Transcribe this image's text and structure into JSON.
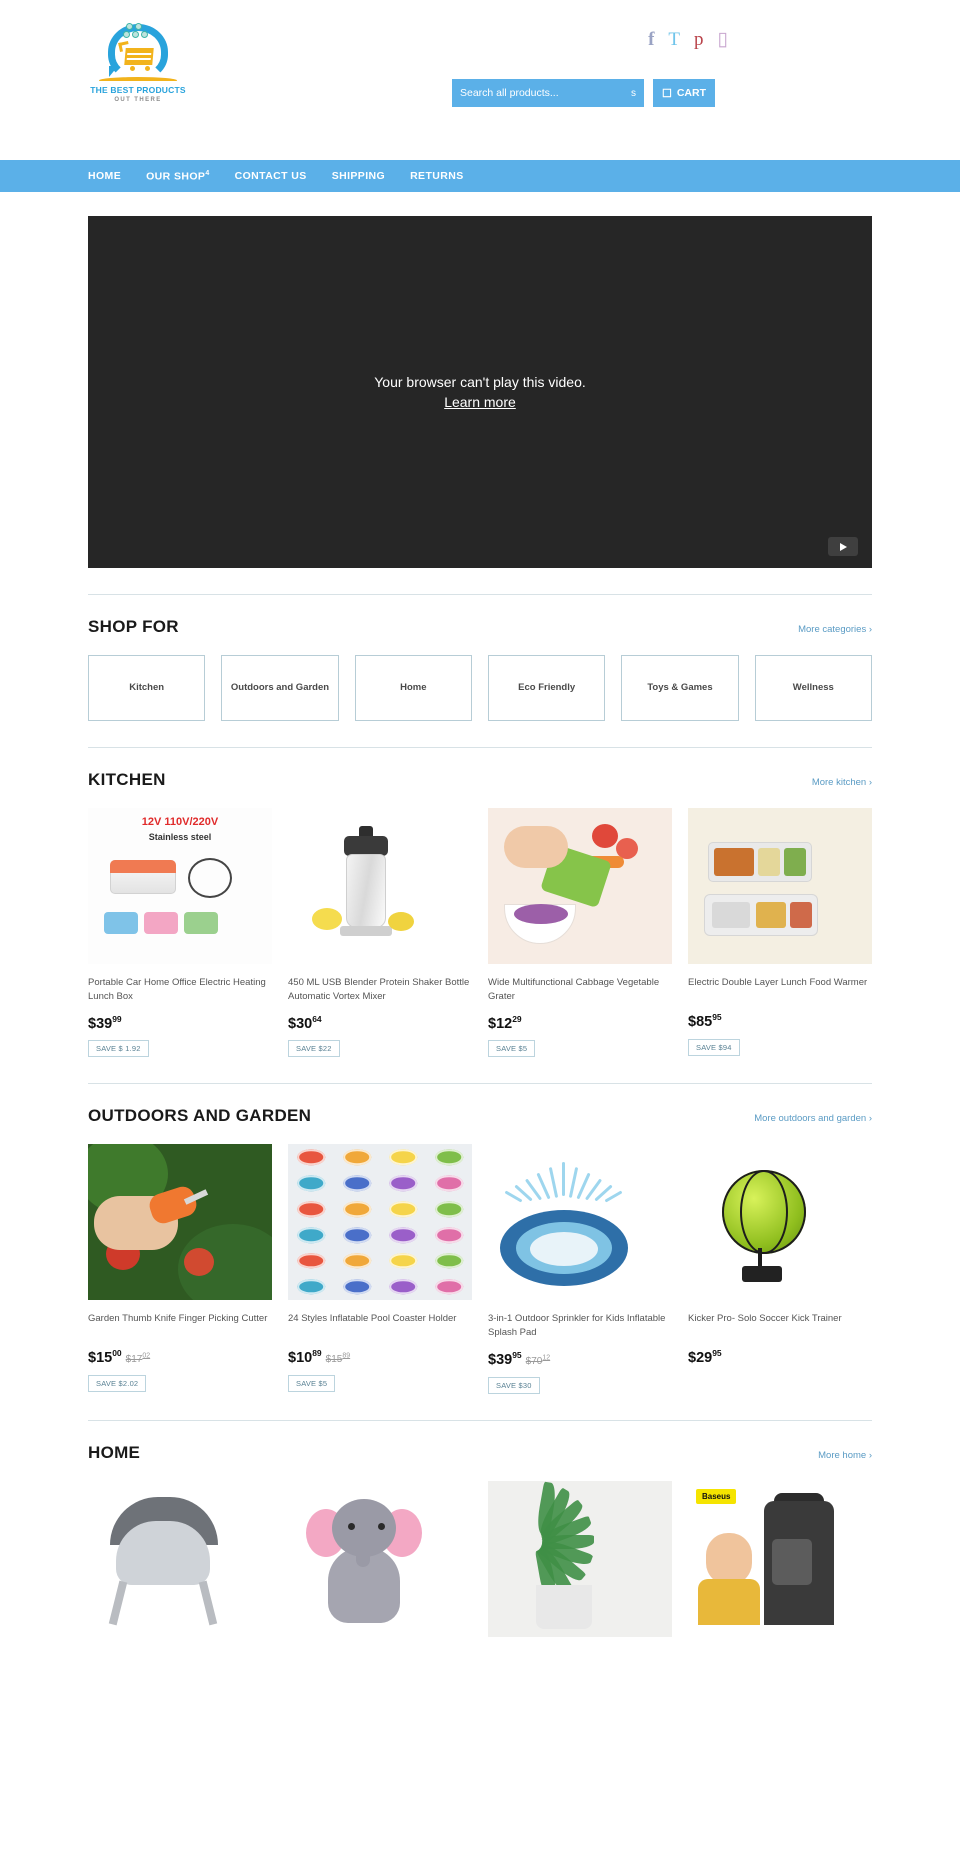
{
  "header": {
    "logo": {
      "name_line1": "THE BEST PRODUCTS",
      "name_line2": "OUT THERE"
    },
    "social": [
      {
        "name": "facebook-icon",
        "glyph": "f"
      },
      {
        "name": "twitter-icon",
        "glyph": "T"
      },
      {
        "name": "pinterest-icon",
        "glyph": "p"
      },
      {
        "name": "instagram-icon",
        "glyph": "▯"
      }
    ],
    "search": {
      "placeholder": "Search all products...",
      "icon": "s"
    },
    "cart": {
      "label": "CART",
      "icon": "☐"
    }
  },
  "nav": [
    {
      "label": "HOME",
      "badge": ""
    },
    {
      "label": "OUR SHOP",
      "badge": "4"
    },
    {
      "label": "CONTACT US",
      "badge": ""
    },
    {
      "label": "SHIPPING",
      "badge": ""
    },
    {
      "label": "RETURNS",
      "badge": ""
    }
  ],
  "video": {
    "message": "Your browser can't play this video.",
    "learn_more": "Learn more",
    "play_icon": "play-icon"
  },
  "shop_for": {
    "title": "SHOP FOR",
    "more": "More categories ›",
    "categories": [
      {
        "label": "Kitchen"
      },
      {
        "label": "Outdoors and Garden"
      },
      {
        "label": "Home"
      },
      {
        "label": "Eco Friendly"
      },
      {
        "label": "Toys & Games"
      },
      {
        "label": "Wellness"
      }
    ]
  },
  "sections": [
    {
      "title": "KITCHEN",
      "more": "More kitchen ›",
      "products": [
        {
          "title": "Portable Car Home Office Electric Heating Lunch Box",
          "price_main": "$39",
          "price_cents": "99",
          "old_main": "",
          "old_cents": "",
          "save": "SAVE $ 1.92"
        },
        {
          "title": "450 ML USB Blender Protein Shaker Bottle Automatic Vortex Mixer",
          "price_main": "$30",
          "price_cents": "64",
          "old_main": "",
          "old_cents": "",
          "save": "SAVE $22"
        },
        {
          "title": "Wide Multifunctional Cabbage Vegetable Grater",
          "price_main": "$12",
          "price_cents": "29",
          "old_main": "",
          "old_cents": "",
          "save": "SAVE $5"
        },
        {
          "title": "Electric Double Layer Lunch Food Warmer",
          "price_main": "$85",
          "price_cents": "95",
          "old_main": "",
          "old_cents": "",
          "save": "SAVE $94"
        }
      ]
    },
    {
      "title": "OUTDOORS AND GARDEN",
      "more": "More outdoors and garden ›",
      "products": [
        {
          "title": "Garden Thumb Knife Finger Picking Cutter",
          "price_main": "$15",
          "price_cents": "00",
          "old_main": "$17",
          "old_cents": "02",
          "save": "SAVE $2.02"
        },
        {
          "title": "24 Styles Inflatable Pool Coaster Holder",
          "price_main": "$10",
          "price_cents": "89",
          "old_main": "$15",
          "old_cents": "89",
          "save": "SAVE $5"
        },
        {
          "title": "3-in-1 Outdoor Sprinkler for Kids Inflatable Splash Pad",
          "price_main": "$39",
          "price_cents": "95",
          "old_main": "$70",
          "old_cents": "12",
          "save": "SAVE $30"
        },
        {
          "title": "Kicker Pro- Solo Soccer Kick Trainer",
          "price_main": "$29",
          "price_cents": "95",
          "old_main": "",
          "old_cents": "",
          "save": ""
        }
      ]
    },
    {
      "title": "HOME",
      "more": "More home ›",
      "products": [
        {
          "title": "",
          "price_main": "",
          "price_cents": "",
          "old_main": "",
          "old_cents": "",
          "save": ""
        },
        {
          "title": "",
          "price_main": "",
          "price_cents": "",
          "old_main": "",
          "old_cents": "",
          "save": ""
        },
        {
          "title": "",
          "price_main": "",
          "price_cents": "",
          "old_main": "",
          "old_cents": "",
          "save": ""
        },
        {
          "title": "",
          "price_main": "",
          "price_cents": "",
          "old_main": "",
          "old_cents": "",
          "save": ""
        }
      ]
    }
  ],
  "home_badge": "Baseus",
  "colors": {
    "accent": "#5bb0e8",
    "logo_blue": "#29a3dc",
    "logo_yellow": "#f2b31c",
    "border": "#b7cdd6",
    "video_bg": "#262626"
  }
}
